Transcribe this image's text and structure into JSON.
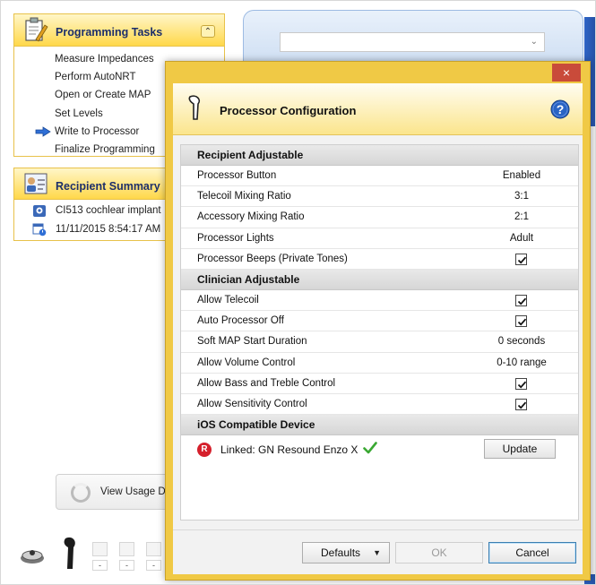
{
  "programming_tasks": {
    "title": "Programming Tasks",
    "items": [
      "Measure Impedances",
      "Perform AutoNRT",
      "Open or Create MAP",
      "Set Levels",
      "Write to Processor",
      "Finalize Programming"
    ],
    "current_index": 4
  },
  "recipient_summary": {
    "title": "Recipient Summary",
    "implant": "CI513 cochlear implant",
    "datetime": "11/11/2015 8:54:17 AM"
  },
  "usage_button": {
    "label": "View Usage Da"
  },
  "bottom_slots": [
    "-",
    "-",
    "-"
  ],
  "dialog": {
    "close_glyph": "×",
    "title": "Processor Configuration",
    "sections": [
      {
        "title": "Recipient Adjustable",
        "rows": [
          {
            "label": "Processor Button",
            "value": "Enabled",
            "type": "text"
          },
          {
            "label": "Telecoil Mixing Ratio",
            "value": "3:1",
            "type": "text"
          },
          {
            "label": "Accessory Mixing Ratio",
            "value": "2:1",
            "type": "text"
          },
          {
            "label": "Processor Lights",
            "value": "Adult",
            "type": "text"
          },
          {
            "label": "Processor Beeps (Private Tones)",
            "value": true,
            "type": "checkbox"
          }
        ]
      },
      {
        "title": "Clinician Adjustable",
        "rows": [
          {
            "label": "Allow Telecoil",
            "value": true,
            "type": "checkbox"
          },
          {
            "label": "Auto Processor Off",
            "value": true,
            "type": "checkbox"
          },
          {
            "label": "Soft MAP Start Duration",
            "value": "0 seconds",
            "type": "text"
          },
          {
            "label": "Allow Volume Control",
            "value": "0-10 range",
            "type": "text"
          },
          {
            "label": "Allow Bass and Treble Control",
            "value": true,
            "type": "checkbox"
          },
          {
            "label": "Allow Sensitivity Control",
            "value": true,
            "type": "checkbox"
          }
        ]
      }
    ],
    "ios": {
      "title": "iOS Compatible Device",
      "badge": "R",
      "linked_text": "Linked: GN Resound Enzo X",
      "update_label": "Update"
    },
    "buttons": {
      "defaults": "Defaults",
      "ok": "OK",
      "cancel": "Cancel"
    }
  },
  "colors": {
    "dialog_frame": "#f0c945",
    "close_red": "#c94b3a",
    "section_header": "#d6d6d6",
    "check_green": "#3aa833",
    "badge_red": "#d5202c",
    "help_blue": "#2a64c4",
    "title_navy": "#1d2f6a"
  },
  "icons": {
    "programming_tasks": "clipboard-edit-icon",
    "recipient_summary": "person-card-icon",
    "current_task": "arrow-right-icon",
    "implant": "implant-icon",
    "datetime": "calendar-clock-icon",
    "processor": "sound-processor-icon",
    "help": "help-icon",
    "linked": "checkmark-icon"
  }
}
